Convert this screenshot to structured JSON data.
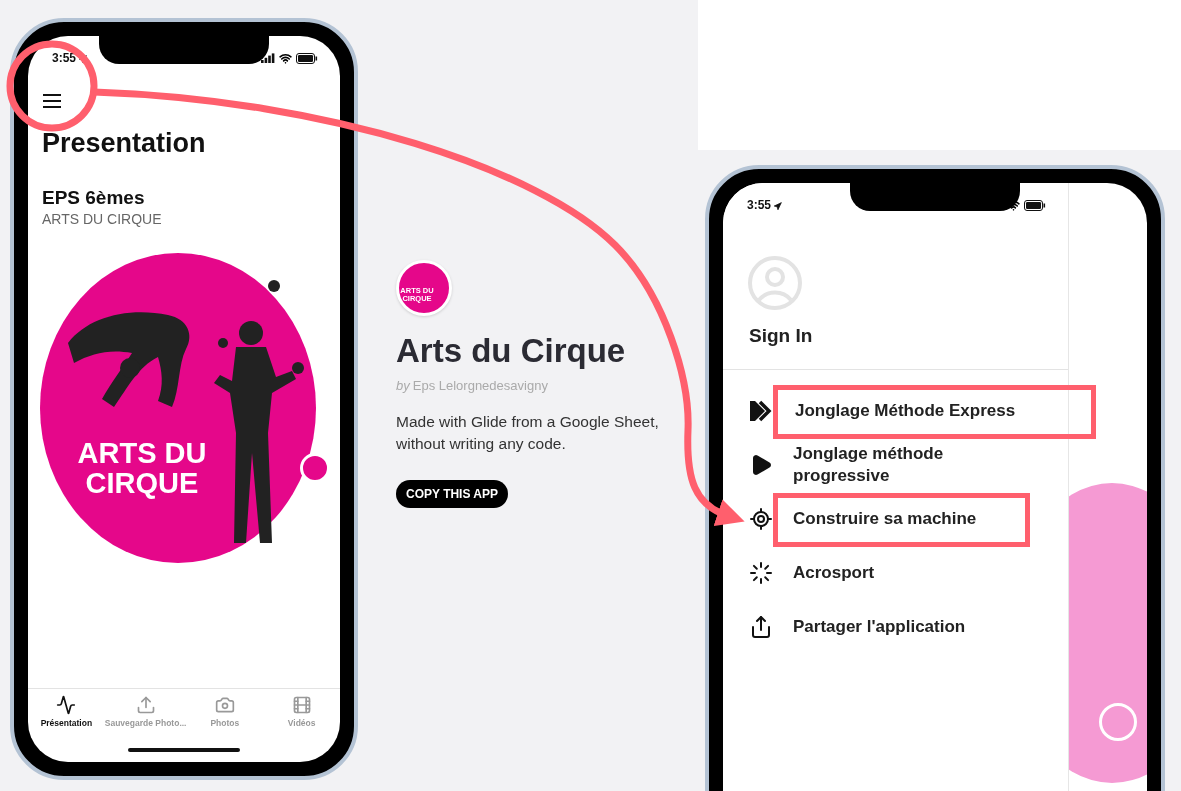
{
  "left_phone": {
    "status_time": "3:55",
    "title": "Presentation",
    "heading": "EPS 6èmes",
    "subheading": "ARTS DU CIRQUE",
    "hero_logo_text": "ARTS DU CIRQUE",
    "tabs": [
      {
        "label": "Présentation",
        "kind": "pulse",
        "selected": true
      },
      {
        "label": "Sauvegarde Photo...",
        "kind": "upload",
        "selected": false
      },
      {
        "label": "Photos",
        "kind": "camera",
        "selected": false
      },
      {
        "label": "Vidéos",
        "kind": "film",
        "selected": false
      }
    ]
  },
  "app_info": {
    "icon_logo_text": "ARTS DU CIRQUE",
    "name": "Arts du Cirque",
    "author_prefix": "by",
    "author": "Eps Lelorgnedesavigny",
    "description": "Made with Glide from a Google Sheet, without writing any code.",
    "button": "COPY THIS APP"
  },
  "right_phone": {
    "status_time": "3:55",
    "sign_in": "Sign In",
    "menu": [
      {
        "label": "Jonglage Méthode Express",
        "kind": "fast-forward",
        "highlighted": true
      },
      {
        "label": "Jonglage méthode progressive",
        "kind": "play",
        "highlighted": false
      },
      {
        "label": "Construire sa machine",
        "kind": "target",
        "highlighted": true
      },
      {
        "label": "Acrosport",
        "kind": "spinner",
        "highlighted": false
      },
      {
        "label": "Partager l'application",
        "kind": "share",
        "highlighted": false
      }
    ]
  }
}
